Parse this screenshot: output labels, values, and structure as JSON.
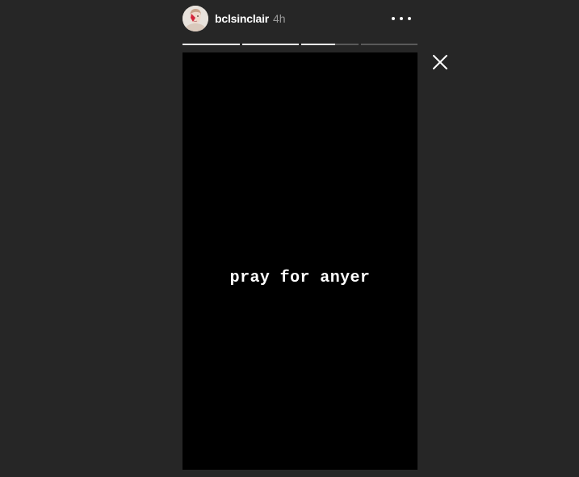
{
  "header": {
    "username": "bclsinclair",
    "timestamp": "4h",
    "avatar_icon": "profile-avatar",
    "more_icon": "ellipsis-horizontal-icon"
  },
  "progress": {
    "segment_count": 4,
    "segments": [
      {
        "filled": 1.0
      },
      {
        "filled": 1.0
      },
      {
        "filled": 0.6
      },
      {
        "filled": 0.0
      }
    ]
  },
  "story": {
    "text": "pray for anyer",
    "background": "#000000"
  },
  "close": {
    "icon": "close-icon"
  },
  "colors": {
    "page_background": "#262626",
    "progress_fill": "#f2f2f2",
    "progress_track": "#5a5a5a",
    "timestamp": "#9a9a9a"
  }
}
